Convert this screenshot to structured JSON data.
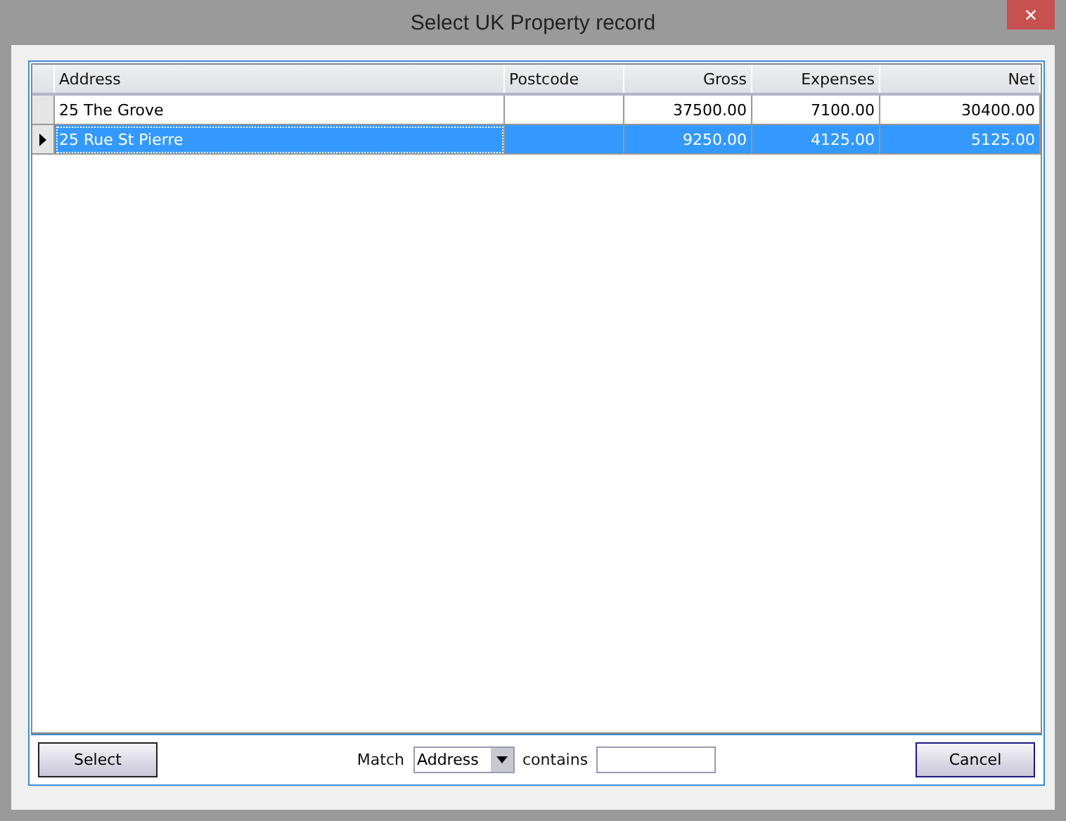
{
  "window": {
    "title": "Select UK Property record",
    "close": "✕"
  },
  "table": {
    "columns": [
      {
        "label": "Address",
        "kind": "text"
      },
      {
        "label": "Postcode",
        "kind": "text"
      },
      {
        "label": "Gross",
        "kind": "number"
      },
      {
        "label": "Expenses",
        "kind": "number"
      },
      {
        "label": "Net",
        "kind": "number"
      }
    ],
    "rows": [
      {
        "selected": false,
        "cells": [
          "25 The Grove",
          "",
          "37500.00",
          "7100.00",
          "30400.00"
        ]
      },
      {
        "selected": true,
        "cells": [
          "25 Rue St Pierre",
          "",
          "9250.00",
          "4125.00",
          "5125.00"
        ]
      }
    ]
  },
  "footer": {
    "select_button": "Select",
    "match_label": "Match",
    "match_field": {
      "value": "Address"
    },
    "contains_label": "contains",
    "cancel_button": "Cancel"
  }
}
